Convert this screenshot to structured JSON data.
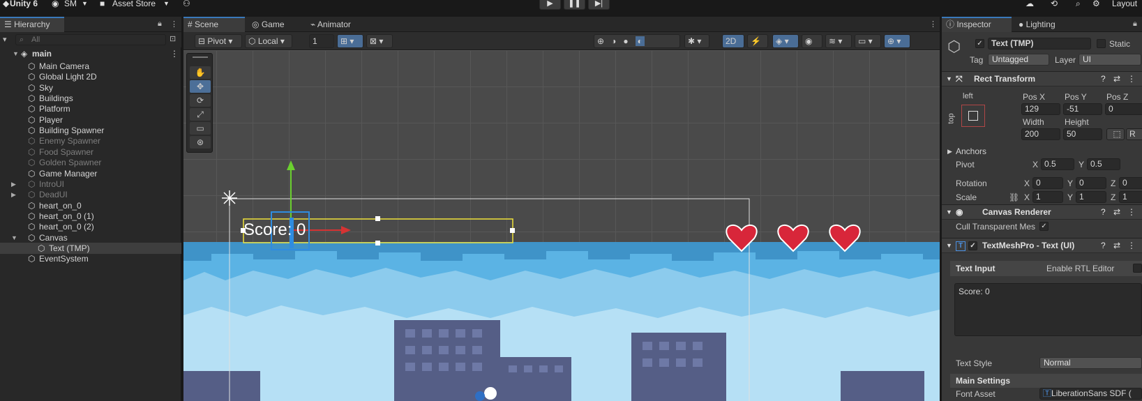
{
  "topbar": {
    "app": "Unity 6",
    "account": "SM",
    "asset_store": "Asset Store",
    "layout": "Layout",
    "play_label": "▶",
    "pause_label": "❚❚",
    "step_label": "▶|"
  },
  "hierarchy": {
    "tab": "Hierarchy",
    "search_placeholder": "All",
    "scene_name": "main",
    "items": [
      {
        "label": "Main Camera",
        "state": "normal"
      },
      {
        "label": "Global Light 2D",
        "state": "normal"
      },
      {
        "label": "Sky",
        "state": "normal"
      },
      {
        "label": "Buildings",
        "state": "normal"
      },
      {
        "label": "Platform",
        "state": "normal"
      },
      {
        "label": "Player",
        "state": "normal"
      },
      {
        "label": "Building Spawner",
        "state": "normal"
      },
      {
        "label": "Enemy Spawner",
        "state": "disabled"
      },
      {
        "label": "Food Spawner",
        "state": "disabled"
      },
      {
        "label": "Golden Spawner",
        "state": "disabled"
      },
      {
        "label": "Game Manager",
        "state": "normal"
      },
      {
        "label": "IntroUI",
        "state": "disabled"
      },
      {
        "label": "DeadUI",
        "state": "disabled"
      },
      {
        "label": "heart_on_0",
        "state": "normal"
      },
      {
        "label": "heart_on_0 (1)",
        "state": "normal"
      },
      {
        "label": "heart_on_0 (2)",
        "state": "normal"
      },
      {
        "label": "Canvas",
        "state": "normal"
      },
      {
        "label": "Text (TMP)",
        "state": "selected"
      },
      {
        "label": "EventSystem",
        "state": "normal"
      }
    ]
  },
  "scene": {
    "tabs": [
      "Scene",
      "Game",
      "Animator"
    ],
    "pivot": "Pivot",
    "local": "Local",
    "grid_value": "1",
    "mode_2d": "2D",
    "score_text": "Score: 0"
  },
  "inspector": {
    "tabs": [
      "Inspector",
      "Lighting"
    ],
    "object_name": "Text (TMP)",
    "static_label": "Static",
    "tag_label": "Tag",
    "tag_value": "Untagged",
    "layer_label": "Layer",
    "layer_value": "UI",
    "rect_transform": "Rect Transform",
    "anchor_h": "left",
    "anchor_v": "top",
    "pos_x_label": "Pos X",
    "pos_x": "129",
    "pos_y_label": "Pos Y",
    "pos_y": "-51",
    "pos_z_label": "Pos Z",
    "pos_z": "0",
    "width_label": "Width",
    "width": "200",
    "height_label": "Height",
    "height": "50",
    "anchors": "Anchors",
    "pivot_label": "Pivot",
    "pivot_x": "0.5",
    "pivot_y": "0.5",
    "rotation_label": "Rotation",
    "rot_x": "0",
    "rot_y": "0",
    "rot_z": "0",
    "scale_label": "Scale",
    "scale_x": "1",
    "scale_y": "1",
    "scale_z": "1",
    "canvas_renderer": "Canvas Renderer",
    "cull_label": "Cull Transparent Mes",
    "tmp_title": "TextMeshPro - Text (UI)",
    "text_input": "Text Input",
    "rtl": "Enable RTL Editor",
    "text_value": "Score: 0",
    "text_style_label": "Text Style",
    "text_style": "Normal",
    "main_settings": "Main Settings",
    "font_asset_label": "Font Asset",
    "font_asset": "LiberationSans SDF ("
  },
  "colors": {
    "accent": "#3a79bb",
    "selection": "#4c6f98",
    "sky": "#4aa3d8"
  }
}
